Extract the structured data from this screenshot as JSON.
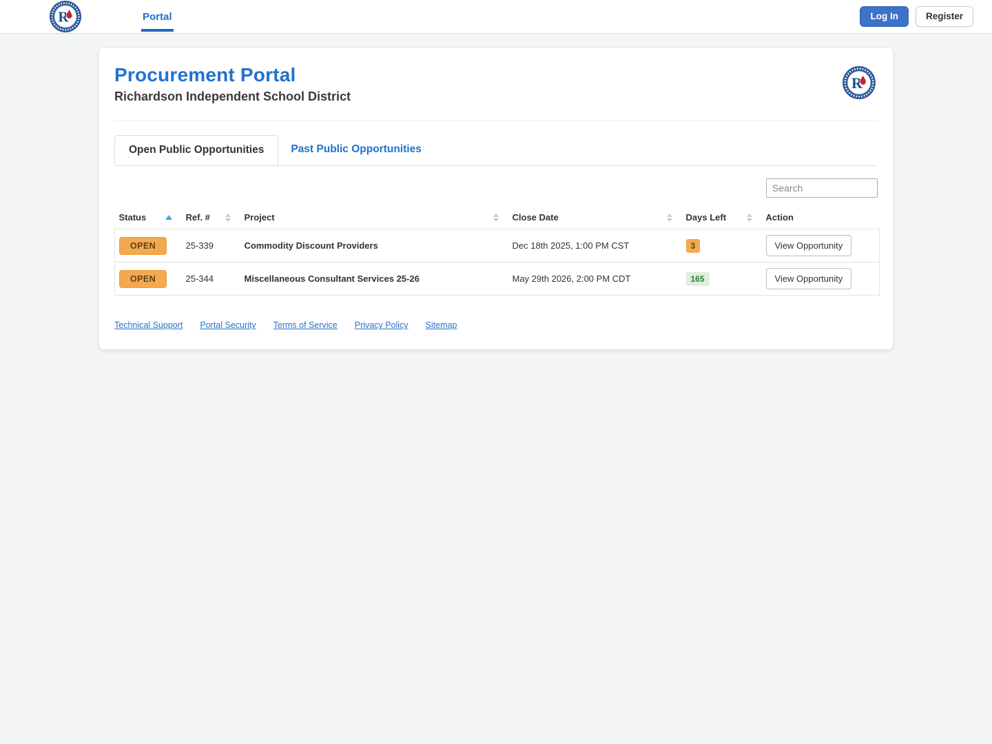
{
  "nav": {
    "portal_label": "Portal",
    "login_label": "Log In",
    "register_label": "Register"
  },
  "header": {
    "title": "Procurement Portal",
    "subtitle": "Richardson Independent School District"
  },
  "tabs": {
    "open_label": "Open Public Opportunities",
    "past_label": "Past Public Opportunities"
  },
  "search": {
    "placeholder": "Search"
  },
  "table": {
    "columns": [
      "Status",
      "Ref. #",
      "Project",
      "Close Date",
      "Days Left",
      "Action"
    ],
    "sort": {
      "column": "Status",
      "direction": "asc"
    },
    "rows": [
      {
        "status": "OPEN",
        "ref": "25-339",
        "project": "Commodity Discount Providers",
        "close_date": "Dec 18th 2025, 1:00 PM CST",
        "days_left": "3",
        "days_left_variant": "orange",
        "action_label": "View Opportunity"
      },
      {
        "status": "OPEN",
        "ref": "25-344",
        "project": "Miscellaneous Consultant Services 25-26",
        "close_date": "May 29th 2026, 2:00 PM CDT",
        "days_left": "165",
        "days_left_variant": "green",
        "action_label": "View Opportunity"
      }
    ]
  },
  "footer": {
    "links": [
      "Technical Support",
      "Portal Security",
      "Terms of Service",
      "Privacy Policy",
      "Sitemap"
    ]
  },
  "colors": {
    "accent_blue": "#2272ce",
    "button_blue": "#3c72c8",
    "open_badge_orange": "#f5a94e",
    "days_green_bg": "#dfeedd",
    "days_green_text": "#2e7d36"
  }
}
